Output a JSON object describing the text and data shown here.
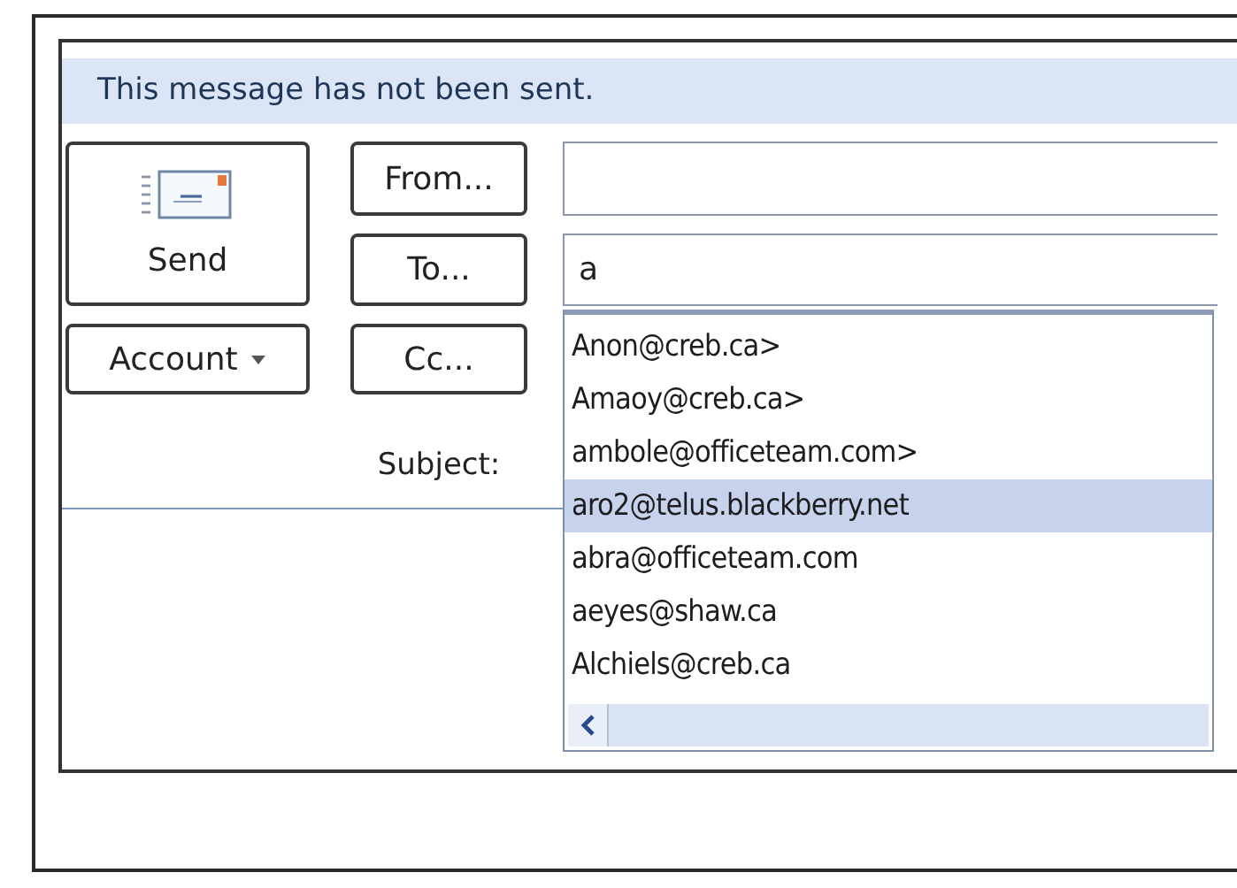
{
  "infobar": "This message has not been sent.",
  "send": {
    "label": "Send"
  },
  "account": {
    "label": "Account"
  },
  "address_buttons": [
    {
      "label": "From..."
    },
    {
      "label": "To..."
    },
    {
      "label": "Cc..."
    }
  ],
  "subject_label": "Subject:",
  "to_value": "a",
  "suggestions": [
    {
      "address": "Anon@creb.ca>",
      "selected": false
    },
    {
      "address": "Amaoy@creb.ca>",
      "selected": false
    },
    {
      "address": "ambole@officeteam.com>",
      "selected": false
    },
    {
      "address": "aro2@telus.blackberry.net",
      "selected": true
    },
    {
      "address": "abra@officeteam.com",
      "selected": false
    },
    {
      "address": "aeyes@shaw.ca",
      "selected": false
    },
    {
      "address": "Alchiels@creb.ca",
      "selected": false
    }
  ]
}
